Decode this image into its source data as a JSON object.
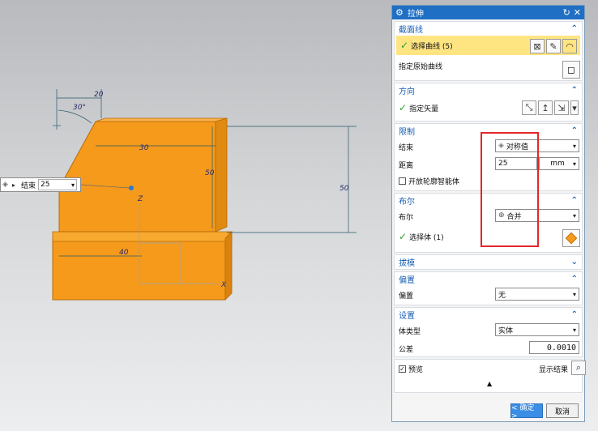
{
  "dialog": {
    "title": "拉伸",
    "sections": {
      "section_curve": {
        "title": "截面线",
        "select_curve_label": "选择曲线 (5)",
        "specify_curve_label": "指定原始曲线"
      },
      "direction": {
        "title": "方向",
        "specify_vector_label": "指定矢量"
      },
      "limits": {
        "title": "限制",
        "end_label": "结束",
        "end_value": "对称值",
        "distance_label": "距离",
        "distance_value": "25",
        "distance_unit": "mm",
        "open_profile_label": "开放轮廓智能体"
      },
      "boolean": {
        "title": "布尔",
        "boolean_label": "布尔",
        "boolean_value": "合并",
        "select_body_label": "选择体 (1)"
      },
      "draft": {
        "title": "拔模"
      },
      "offset": {
        "title": "偏置",
        "offset_label": "偏置",
        "offset_value": "无"
      },
      "settings": {
        "title": "设置",
        "body_type_label": "体类型",
        "body_type_value": "实体",
        "tolerance_label": "公差",
        "tolerance_value": "0.0010"
      }
    },
    "preview_label": "预览",
    "show_result_label": "显示结果",
    "ok_label": "< 确定 >",
    "cancel_label": "取消"
  },
  "floating_input": {
    "label": "结束",
    "value": "25"
  },
  "viewport": {
    "dims": [
      "20",
      "30°",
      "30",
      "50",
      "50",
      "40"
    ],
    "axis_z": "Z",
    "axis_x": "X"
  },
  "colors": {
    "title_bar": "#1f6fc4",
    "selection_highlight": "#ffe482",
    "solid_body": "#f59a1b",
    "annotation_box": "#e5262a"
  }
}
